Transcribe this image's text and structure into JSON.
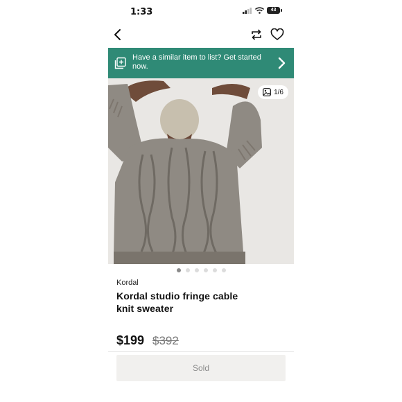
{
  "status_bar": {
    "time": "1:33",
    "battery": "43"
  },
  "banner": {
    "text": "Have a similar item to list? Get started now."
  },
  "gallery": {
    "counter": "1/6",
    "total_images": 6,
    "active_index": 0
  },
  "listing": {
    "brand": "Kordal",
    "title": "Kordal studio fringe cable knit sweater",
    "price": "$199",
    "original_price": "$392"
  },
  "actions": {
    "sold_label": "Sold"
  },
  "colors": {
    "banner": "#2f8a76",
    "sold_bg": "#f1f0ee"
  },
  "icons": [
    "back-icon",
    "repost-icon",
    "heart-icon",
    "list-item-icon",
    "chevron-right-icon",
    "gallery-icon"
  ]
}
